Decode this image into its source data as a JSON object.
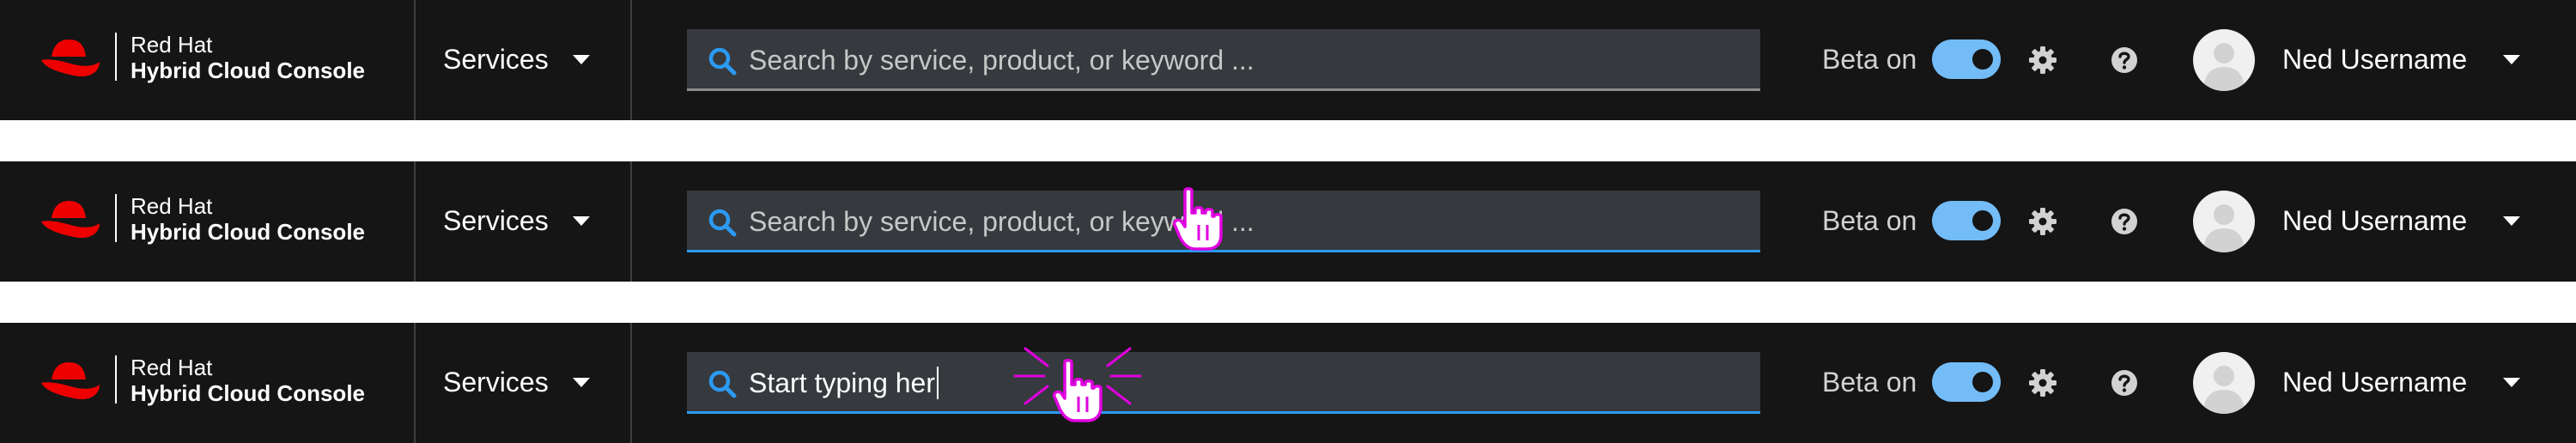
{
  "brand": {
    "line1": "Red Hat",
    "line2": "Hybrid Cloud Console"
  },
  "colors": {
    "masthead": "#151515",
    "search_bg": "#36393d",
    "focus_underline": "#2b9af3",
    "toggle_on": "#73bcf7",
    "brand_red": "#ee0000",
    "pointer_magenta": "#e000e0"
  },
  "frames": [
    {
      "services_label": "Services",
      "search": {
        "placeholder": "Search by service, product, or keyword ...",
        "value": ""
      },
      "beta_label": "Beta on",
      "beta_on": true,
      "user_name": "Ned Username",
      "icons": [
        "red-hat-logo-icon",
        "chevron-down-icon",
        "search-icon",
        "gear-icon",
        "help-icon",
        "avatar-icon",
        "chevron-down-icon"
      ]
    },
    {
      "services_label": "Services",
      "search": {
        "placeholder": "Search by service, product, or keyword ...",
        "value": ""
      },
      "beta_label": "Beta on",
      "beta_on": true,
      "user_name": "Ned Username",
      "pointer": "hand-pointer-icon"
    },
    {
      "services_label": "Services",
      "search": {
        "placeholder": "",
        "value": "Start typing her"
      },
      "beta_label": "Beta on",
      "beta_on": true,
      "user_name": "Ned Username",
      "pointer": "hand-pointer-click-icon"
    }
  ]
}
